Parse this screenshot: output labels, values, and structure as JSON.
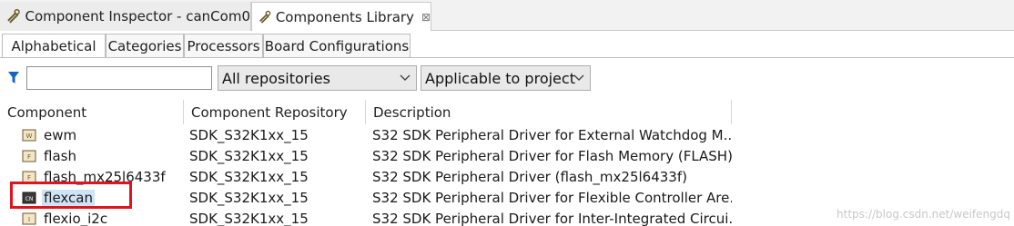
{
  "editor_tabs": [
    {
      "label": "Component Inspector - canCom0",
      "icon": "inspector-icon"
    },
    {
      "label": "Components Library",
      "icon": "library-icon",
      "close": "⊠"
    }
  ],
  "sub_tabs": [
    "Alphabetical",
    "Categories",
    "Processors",
    "Board Configurations"
  ],
  "filter": {
    "search_value": "",
    "repository_selected": "All repositories",
    "project_filter_selected": "Applicable to project"
  },
  "table": {
    "columns": [
      "Component",
      "Component Repository",
      "Description"
    ],
    "rows": [
      {
        "name": "ewm",
        "repo": "SDK_S32K1xx_15",
        "desc": "S32 SDK Peripheral Driver for External Watchdog M..."
      },
      {
        "name": "flash",
        "repo": "SDK_S32K1xx_15",
        "desc": "S32 SDK Peripheral Driver for Flash Memory (FLASH)"
      },
      {
        "name": "flash_mx25l6433f",
        "repo": "SDK_S32K1xx_15",
        "desc": "S32 SDK Peripheral Driver (flash_mx25l6433f)"
      },
      {
        "name": "flexcan",
        "repo": "SDK_S32K1xx_15",
        "desc": "S32 SDK Peripheral Driver for Flexible Controller Are..."
      },
      {
        "name": "flexio_i2c",
        "repo": "SDK_S32K1xx_15",
        "desc": "S32 SDK Peripheral Driver for Inter-Integrated Circui..."
      }
    ]
  },
  "watermark": "https://blog.csdn.net/weifengdq",
  "colors": {
    "selection": "#cfe3f7",
    "highlight": "#e0141e",
    "filter_icon": "#1565c0"
  }
}
